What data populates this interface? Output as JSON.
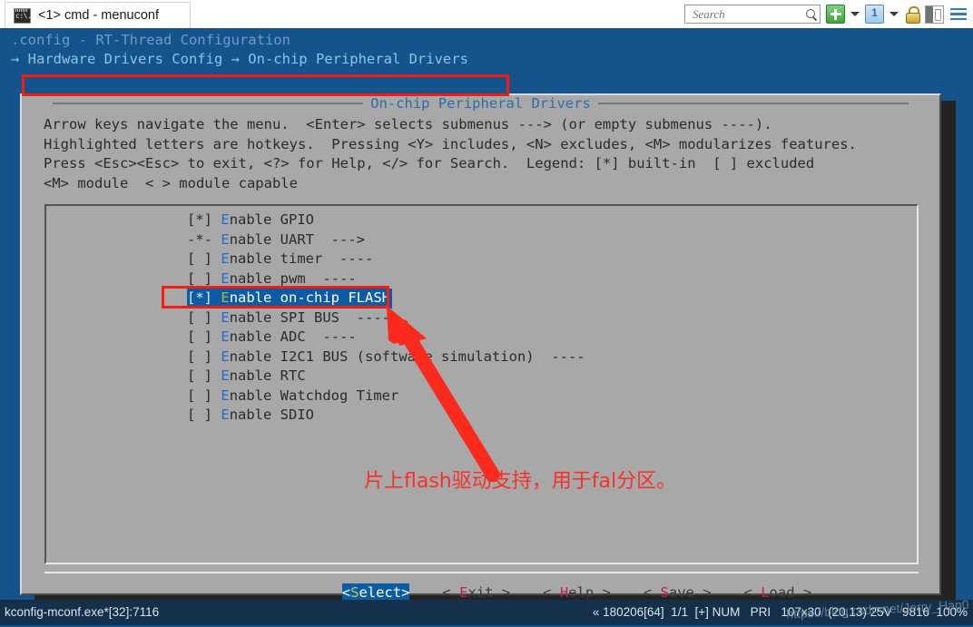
{
  "window": {
    "tab_label": "<1> cmd - menuconf",
    "tab_icon": "console-icon"
  },
  "toolbar": {
    "search_placeholder": "Search",
    "search_value": "",
    "icons": [
      {
        "name": "new-tab-icon",
        "glyph": "plus"
      },
      {
        "name": "new-tab-dropdown-icon",
        "glyph": "caret-down"
      },
      {
        "name": "window-list-icon",
        "glyph": "window-1"
      },
      {
        "name": "window-list-dropdown-icon",
        "glyph": "caret-down"
      },
      {
        "name": "lock-icon",
        "glyph": "padlock"
      },
      {
        "name": "pane-toggle-icon",
        "glyph": "split-pane"
      },
      {
        "name": "hamburger-menu-icon",
        "glyph": "hamburger"
      }
    ]
  },
  "console": {
    "config_line": ".config - RT-Thread Configuration",
    "breadcrumb": "→ Hardware Drivers Config → On-chip Peripheral Drivers"
  },
  "dialog": {
    "title": "On-chip Peripheral Drivers",
    "help_text": "Arrow keys navigate the menu.  <Enter> selects submenus ---> (or empty submenus ----).\nHighlighted letters are hotkeys.  Pressing <Y> includes, <N> excludes, <M> modularizes features.\nPress <Esc><Esc> to exit, <?> for Help, </> for Search.  Legend: [*] built-in  [ ] excluded\n<M> module  < > module capable",
    "items": [
      {
        "mark": "[*]",
        "hotkey": "E",
        "label": "nable GPIO",
        "tail": "",
        "selected": false
      },
      {
        "mark": "-*-",
        "hotkey": "E",
        "label": "nable UART",
        "tail": "  --->",
        "selected": false
      },
      {
        "mark": "[ ]",
        "hotkey": "E",
        "label": "nable timer",
        "tail": "  ----",
        "selected": false
      },
      {
        "mark": "[ ]",
        "hotkey": "E",
        "label": "nable pwm",
        "tail": "  ----",
        "selected": false
      },
      {
        "mark": "[*]",
        "hotkey": "E",
        "label": "nable on-chip FLASH",
        "tail": "",
        "selected": true
      },
      {
        "mark": "[ ]",
        "hotkey": "E",
        "label": "nable SPI BUS",
        "tail": "  ----",
        "selected": false
      },
      {
        "mark": "[ ]",
        "hotkey": "E",
        "label": "nable ADC",
        "tail": "  ----",
        "selected": false
      },
      {
        "mark": "[ ]",
        "hotkey": "E",
        "label": "nable I2C1 BUS (software simulation)",
        "tail": "  ----",
        "selected": false
      },
      {
        "mark": "[ ]",
        "hotkey": "E",
        "label": "nable RTC",
        "tail": "",
        "selected": false
      },
      {
        "mark": "[ ]",
        "hotkey": "E",
        "label": "nable Watchdog Timer",
        "tail": "",
        "selected": false
      },
      {
        "mark": "[ ]",
        "hotkey": "E",
        "label": "nable SDIO",
        "tail": "",
        "selected": false
      }
    ],
    "buttons": [
      {
        "pre": "<",
        "key": "S",
        "rest": "elect",
        "post": ">",
        "active": true
      },
      {
        "pre": "< ",
        "key": "E",
        "rest": "xit",
        "post": " >",
        "active": false
      },
      {
        "pre": "< ",
        "key": "H",
        "rest": "elp",
        "post": " >",
        "active": false
      },
      {
        "pre": "< ",
        "key": "S",
        "rest": "ave",
        "post": " >",
        "active": false
      },
      {
        "pre": "< ",
        "key": "L",
        "rest": "oad",
        "post": " >",
        "active": false
      }
    ]
  },
  "annotations": {
    "note_cn": "片上flash驱动支持，用于fal分区。",
    "highlight_color": "#f81c10",
    "arrow_color": "#fa2a1c"
  },
  "statusbar": {
    "left": "kconfig-mconf.exe*[32]:7116",
    "right": "« 180206[64]  1/1  [+] NUM   PRI   107x30  (20,13) 25V   9816  100%",
    "watermark": "https://blog.csdn.net/Jerry_Han0"
  }
}
